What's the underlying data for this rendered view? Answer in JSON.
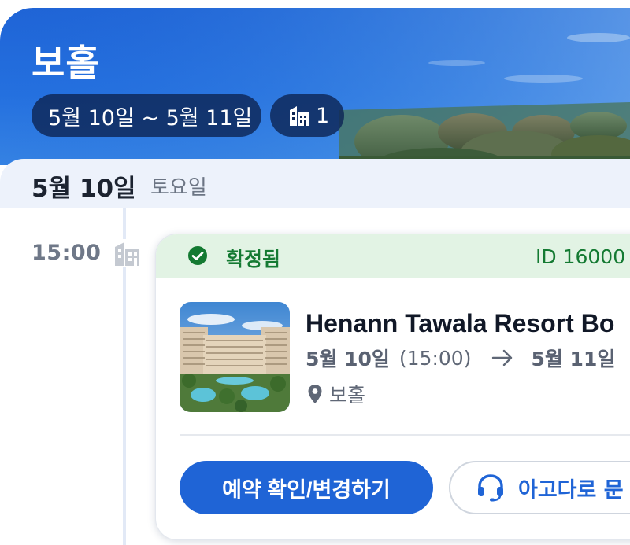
{
  "header": {
    "title": "보홀",
    "date_range": "5월 10일 ~ 5월 11일",
    "rooms_count": "1"
  },
  "date_section": {
    "date": "5월 10일",
    "weekday": "토요일"
  },
  "timeline": {
    "time": "15:00",
    "icon": "building-icon"
  },
  "booking": {
    "status": "확정됨",
    "booking_id": "ID 16000",
    "hotel_name": "Henann Tawala Resort Bo",
    "checkin_date": "5월 10일",
    "checkin_time": "(15:00)",
    "checkout_date": "5월 11일",
    "location": "보홀",
    "primary_button": "예약 확인/변경하기",
    "secondary_button": "아고다로 문"
  },
  "colors": {
    "brand_blue": "#1f64d6",
    "confirmed_green": "#147a32",
    "confirmed_bg": "#e2f3e4",
    "date_row_bg": "#edf2fb"
  }
}
